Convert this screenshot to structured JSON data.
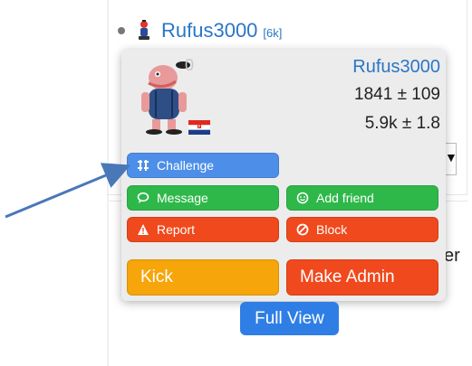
{
  "user_row": {
    "name": "Rufus3000",
    "rating_badge": "[6k]",
    "status_color": "#777777"
  },
  "profile_card": {
    "name": "Rufus3000",
    "rating": "1841 ± 109",
    "games": "5.9k ± 1.8",
    "avatar_status": "0",
    "flag": "croatia-flag-icon"
  },
  "actions": {
    "challenge": "Challenge",
    "message": "Message",
    "add_friend": "Add friend",
    "report": "Report",
    "block": "Block",
    "kick": "Kick",
    "make_admin": "Make Admin"
  },
  "full_view": "Full View",
  "background": {
    "partial_text": "er",
    "select_arrow": "▼"
  },
  "colors": {
    "link_blue": "#2a76c6",
    "challenge_blue": "#4d8fe8",
    "green": "#2fb84a",
    "red": "#f0491d",
    "orange": "#f6a50a",
    "full_view_blue": "#2f7ee6",
    "annotation_arrow": "#4a77b8"
  }
}
